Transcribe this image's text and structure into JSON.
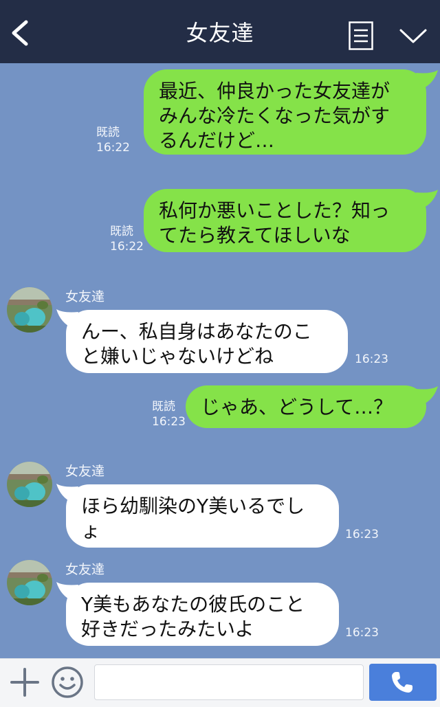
{
  "header": {
    "title": "女友達",
    "back_icon": "chevron-left-icon",
    "menu_icon": "menu-icon",
    "collapse_icon": "chevron-down-icon",
    "background_color": "#232d46"
  },
  "chat": {
    "background_color": "#7493c4",
    "outgoing_bubble_color": "#85e249",
    "incoming_bubble_color": "#ffffff",
    "messages": [
      {
        "direction": "outgoing",
        "lines": [
          "最近、仲良かった女友達が",
          "みんな冷たくなった気がす",
          "るんだけど…"
        ],
        "read_label": "既読",
        "time": "16:22"
      },
      {
        "direction": "outgoing",
        "lines": [
          "私何か悪いことした？知っ",
          "てたら教えてほしいな"
        ],
        "read_label": "既読",
        "time": "16:22"
      },
      {
        "direction": "incoming",
        "sender": "女友達",
        "lines": [
          "んー、私自身はあなたのこ",
          "と嫌いじゃないけどね"
        ],
        "time": "16:23"
      },
      {
        "direction": "outgoing",
        "lines": [
          "じゃあ、どうして…？"
        ],
        "read_label": "既読",
        "time": "16:23"
      },
      {
        "direction": "incoming",
        "sender": "女友達",
        "lines": [
          "ほら幼馴染のY美いるでし",
          "ょ"
        ],
        "time": "16:23"
      },
      {
        "direction": "incoming",
        "sender": "女友達",
        "lines": [
          "Y美もあなたの彼氏のこと",
          "好きだったみたいよ"
        ],
        "time": "16:23"
      }
    ]
  },
  "footer": {
    "plus_icon": "plus-icon",
    "emoji_icon": "smile-icon",
    "input_value": "",
    "call_icon": "phone-icon",
    "call_button_color": "#4a7fdb"
  }
}
